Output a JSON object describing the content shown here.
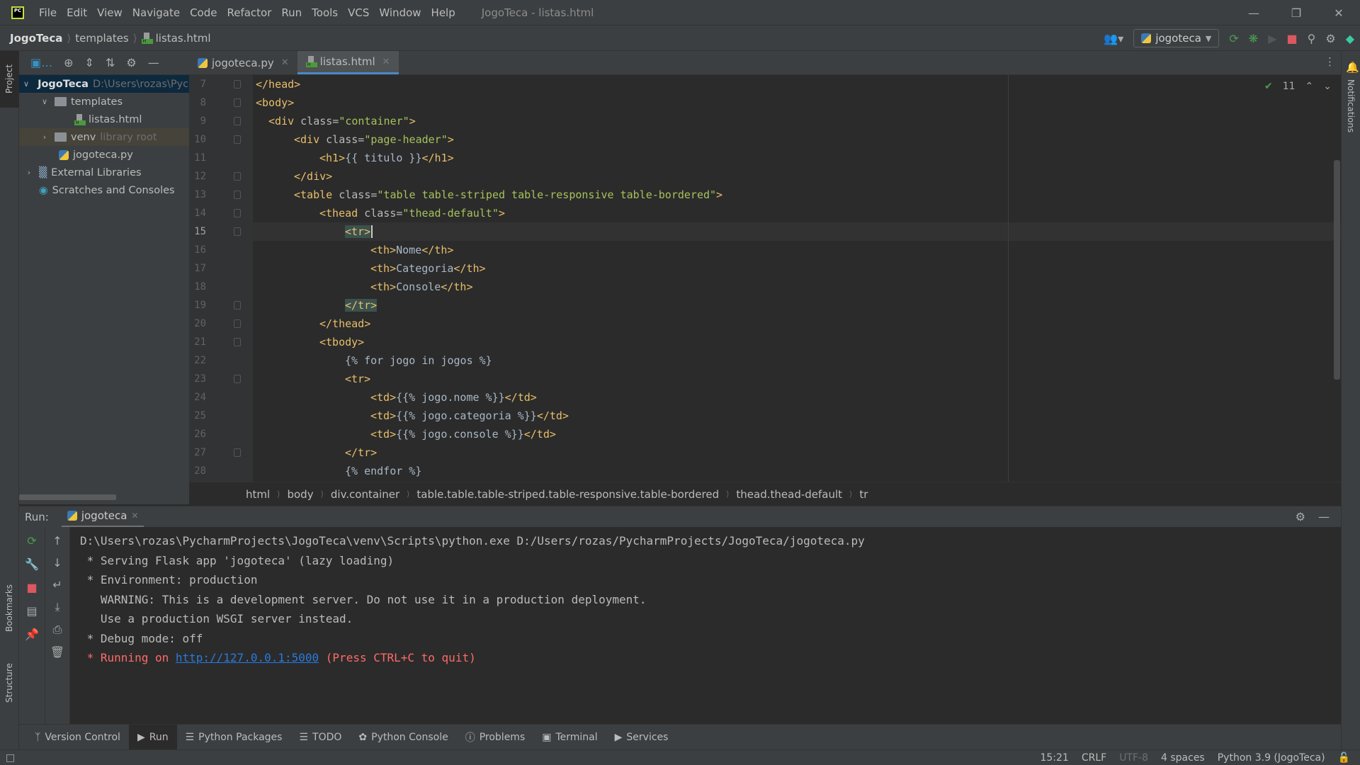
{
  "titlebar": {
    "menu": [
      "File",
      "Edit",
      "View",
      "Navigate",
      "Code",
      "Refactor",
      "Run",
      "Tools",
      "VCS",
      "Window",
      "Help"
    ],
    "window_title": "JogoTeca - listas.html"
  },
  "navbar": {
    "breadcrumb": [
      "JogoTeca",
      "templates",
      "listas.html"
    ],
    "run_config": "jogoteca"
  },
  "left_strip": {
    "project": "Project",
    "bookmarks": "Bookmarks",
    "structure": "Structure"
  },
  "right_strip": {
    "notifications": "Notifications"
  },
  "project_tree": [
    {
      "label": "JogoTeca",
      "path": "D:\\Users\\rozas\\PycharmProjects\\JogoTeca",
      "type": "folder",
      "expanded": true,
      "selected": true
    },
    {
      "label": "templates",
      "type": "folder",
      "expanded": true
    },
    {
      "label": "listas.html",
      "type": "html"
    },
    {
      "label": "venv",
      "note": "library root",
      "type": "folder",
      "expanded": false
    },
    {
      "label": "jogoteca.py",
      "type": "python"
    },
    {
      "label": "External Libraries",
      "type": "library",
      "expanded": false
    },
    {
      "label": "Scratches and Consoles",
      "type": "scratch"
    }
  ],
  "editor": {
    "tabs": [
      {
        "label": "jogoteca.py",
        "active": false
      },
      {
        "label": "listas.html",
        "active": true
      }
    ],
    "inspection_count": "11",
    "lines": [
      {
        "n": "7"
      },
      {
        "n": "8"
      },
      {
        "n": "9"
      },
      {
        "n": "10"
      },
      {
        "n": "11"
      },
      {
        "n": "12"
      },
      {
        "n": "13"
      },
      {
        "n": "14"
      },
      {
        "n": "15"
      },
      {
        "n": "16"
      },
      {
        "n": "17"
      },
      {
        "n": "18"
      },
      {
        "n": "19"
      },
      {
        "n": "20"
      },
      {
        "n": "21"
      },
      {
        "n": "22"
      },
      {
        "n": "23"
      },
      {
        "n": "24"
      },
      {
        "n": "25"
      },
      {
        "n": "26"
      },
      {
        "n": "27"
      },
      {
        "n": "28"
      }
    ],
    "code": {
      "l7": "</head>",
      "l8": "<body>",
      "l9_tag": "<div ",
      "l9_attr": "class=",
      "l9_str": "\"container\"",
      "l9_end": ">",
      "l10_tag": "<div ",
      "l10_attr": "class=",
      "l10_str": "\"page-header\"",
      "l10_end": ">",
      "l11_open": "<h1>",
      "l11_txt": "{{ titulo }}",
      "l11_close": "</h1>",
      "l12": "</div>",
      "l13_tag": "<table ",
      "l13_attr": "class=",
      "l13_str": "\"table table-striped table-responsive table-bordered\"",
      "l13_end": ">",
      "l14_tag": "<thead ",
      "l14_attr": "class=",
      "l14_str": "\"thead-default\"",
      "l14_end": ">",
      "l15": "<tr>",
      "l16_open": "<th>",
      "l16_txt": "Nome",
      "l16_close": "</th>",
      "l17_open": "<th>",
      "l17_txt": "Categoria",
      "l17_close": "</th>",
      "l18_open": "<th>",
      "l18_txt": "Console",
      "l18_close": "</th>",
      "l19": "</tr>",
      "l20": "</thead>",
      "l21": "<tbody>",
      "l22": "{% for jogo in jogos %}",
      "l23": "<tr>",
      "l24_open": "<td>",
      "l24_txt": "{{% jogo.nome %}}",
      "l24_close": "</td>",
      "l25_open": "<td>",
      "l25_txt": "{{% jogo.categoria %}}",
      "l25_close": "</td>",
      "l26_open": "<td>",
      "l26_txt": "{{% jogo.console %}}",
      "l26_close": "</td>",
      "l27": "</tr>",
      "l28": "{% endfor %}"
    },
    "breadcrumb": [
      "html",
      "body",
      "div.container",
      "table.table.table-striped.table-responsive.table-bordered",
      "thead.thead-default",
      "tr"
    ]
  },
  "run_panel": {
    "label": "Run:",
    "tab": "jogoteca",
    "output": [
      "D:\\Users\\rozas\\PycharmProjects\\JogoTeca\\venv\\Scripts\\python.exe D:/Users/rozas/PycharmProjects/JogoTeca/jogoteca.py",
      " * Serving Flask app 'jogoteca' (lazy loading)",
      " * Environment: production",
      "   WARNING: This is a development server. Do not use it in a production deployment.",
      "   Use a production WSGI server instead.",
      " * Debug mode: off"
    ],
    "running_prefix": " * Running on ",
    "running_url": "http://127.0.0.1:5000",
    "running_suffix": " (Press CTRL+C to quit)"
  },
  "tool_windows": [
    {
      "label": "Version Control",
      "icon": "branch-icon"
    },
    {
      "label": "Run",
      "icon": "run-icon",
      "active": true
    },
    {
      "label": "Python Packages",
      "icon": "packages-icon"
    },
    {
      "label": "TODO",
      "icon": "list-icon"
    },
    {
      "label": "Python Console",
      "icon": "python-icon"
    },
    {
      "label": "Problems",
      "icon": "warning-icon"
    },
    {
      "label": "Terminal",
      "icon": "terminal-icon"
    },
    {
      "label": "Services",
      "icon": "services-icon"
    }
  ],
  "statusbar": {
    "position": "15:21",
    "line_sep": "CRLF",
    "encoding": "UTF-8",
    "indent": "4 spaces",
    "interpreter": "Python 3.9 (JogoTeca)"
  }
}
